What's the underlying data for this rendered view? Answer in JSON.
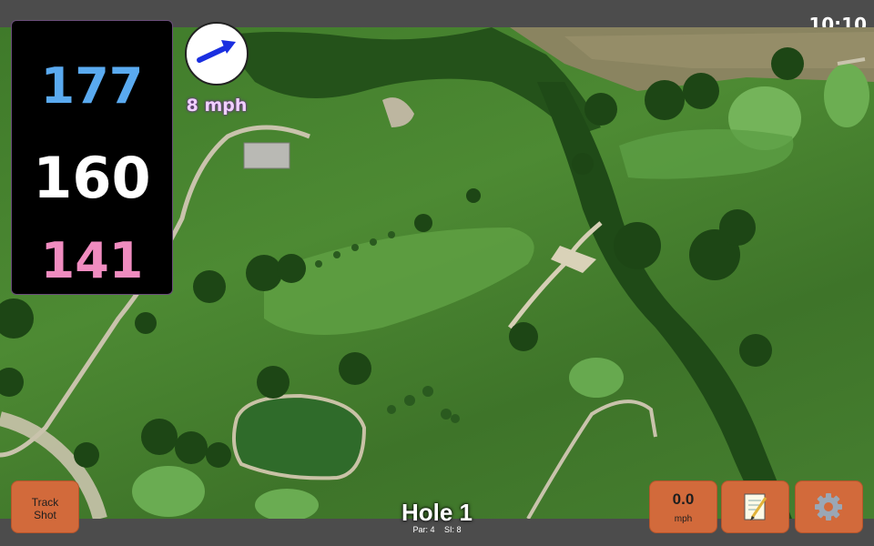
{
  "clock": "10:10",
  "yardages": {
    "back": "177",
    "middle": "160",
    "front": "141"
  },
  "wind": {
    "speed_label": "8 mph",
    "icon": "wind-arrow-icon",
    "arrow_color": "#1a2fe0"
  },
  "buttons": {
    "track_shot": "Track\nShot",
    "speed_value": "0.0",
    "speed_unit": "mph",
    "notes_icon": "notepad-icon",
    "settings_icon": "gear-icon"
  },
  "hole": {
    "title": "Hole 1",
    "par": "Par: 4",
    "si": "SI: 8"
  },
  "colors": {
    "accent_button": "#d26a3b",
    "back_yardage": "#5aaaf0",
    "middle_yardage": "#ffffff",
    "front_yardage": "#f08cc0",
    "bar": "#4c4c4c"
  }
}
